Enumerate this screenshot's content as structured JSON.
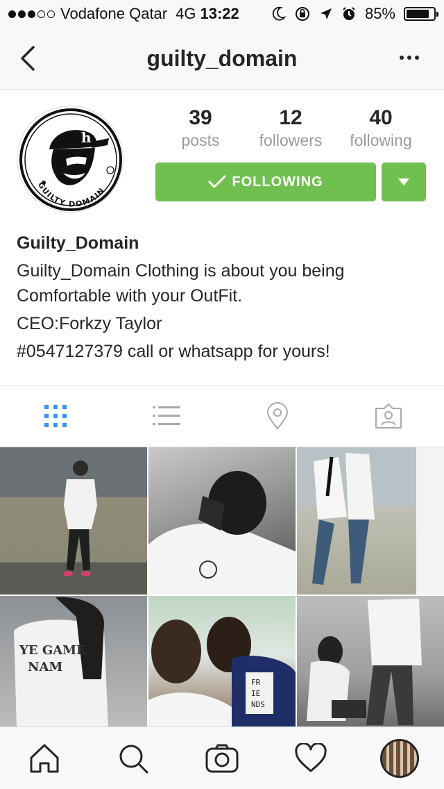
{
  "status_bar": {
    "carrier": "Vodafone Qatar",
    "network": "4G",
    "time": "13:22",
    "battery": "85%",
    "battery_level": 0.85
  },
  "nav": {
    "title": "guilty_domain",
    "back_icon": "chevron-left-icon",
    "more_icon": "more-horizontal-icon"
  },
  "profile": {
    "stats": [
      {
        "value": "39",
        "label": "posts"
      },
      {
        "value": "12",
        "label": "followers"
      },
      {
        "value": "40",
        "label": "following"
      }
    ],
    "follow_button": "FOLLOWING",
    "accent_color": "#70c050",
    "name": "Guilty_Domain",
    "bio_lines": [
      "Guilty_Domain Clothing is about you being",
      "Comfortable with your OutFit.",
      "CEO:Forkzy Taylor",
      "#0547127379 call or whatsapp for yours!"
    ],
    "logo_text": "GUILTY DOMAIN",
    "logo_mark": "h"
  },
  "tabs": [
    {
      "icon": "grid-icon",
      "active": true
    },
    {
      "icon": "list-icon",
      "active": false
    },
    {
      "icon": "location-pin-icon",
      "active": false
    },
    {
      "icon": "tagged-person-icon",
      "active": false
    }
  ],
  "posts": {
    "tile4_text": [
      "YE GAME",
      "NAM"
    ],
    "tile5_text": [
      "FR",
      "IE",
      "NDS"
    ]
  },
  "bottom_bar": [
    {
      "icon": "home-icon"
    },
    {
      "icon": "search-icon"
    },
    {
      "icon": "camera-icon"
    },
    {
      "icon": "heart-icon"
    },
    {
      "icon": "profile-avatar-icon"
    }
  ]
}
